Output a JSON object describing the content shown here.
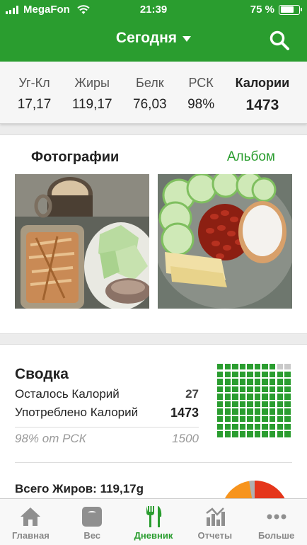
{
  "status_bar": {
    "carrier": "MegaFon",
    "time": "21:39",
    "battery": "75 %"
  },
  "nav": {
    "title": "Сегодня"
  },
  "macros": [
    {
      "label": "Уг-Кл",
      "value": "17,17"
    },
    {
      "label": "Жиры",
      "value": "119,17"
    },
    {
      "label": "Белк",
      "value": "76,03"
    },
    {
      "label": "РСК",
      "value": "98%"
    },
    {
      "label": "Калории",
      "value": "1473"
    }
  ],
  "photos": {
    "title": "Фотографии",
    "album_link": "Альбом"
  },
  "summary": {
    "title": "Сводка",
    "remaining_label": "Осталось Калорий",
    "remaining_value": "27",
    "consumed_label": "Употреблено Калорий",
    "consumed_value": "1473",
    "percent_label": "98% от РСК",
    "target_value": "1500",
    "waffle_filled_fraction": 0.98
  },
  "fat": {
    "total_label": "Всего Жиров: 119,17g"
  },
  "tabs": [
    {
      "label": "Главная",
      "icon": "home-icon",
      "active": false
    },
    {
      "label": "Вес",
      "icon": "scale-icon",
      "active": false
    },
    {
      "label": "Дневник",
      "icon": "fork-knife-icon",
      "active": true
    },
    {
      "label": "Отчеты",
      "icon": "reports-icon",
      "active": false
    },
    {
      "label": "Больше",
      "icon": "more-icon",
      "active": false
    }
  ],
  "colors": {
    "brand_green": "#2a9d2f",
    "pie_orange": "#f7941d",
    "pie_red": "#e5361b",
    "pie_gray": "#b0b0b0"
  }
}
